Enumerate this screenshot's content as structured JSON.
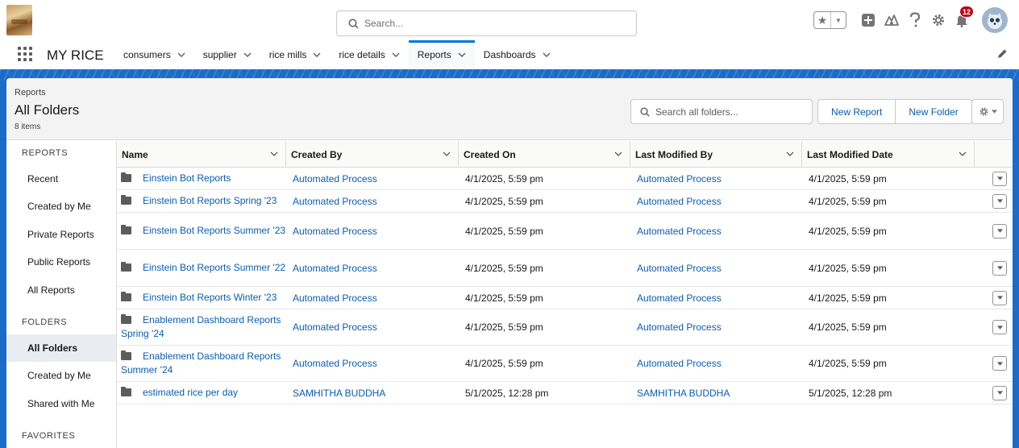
{
  "header": {
    "search_placeholder": "Search...",
    "notification_count": "12",
    "icons": [
      "logo",
      "search-icon",
      "star-icon",
      "chevron-down-icon",
      "add-icon",
      "trailhead-icon",
      "help-icon",
      "gear-icon",
      "bell-icon",
      "avatar"
    ]
  },
  "nav": {
    "app_name": "MY RICE",
    "items": [
      {
        "label": "consumers"
      },
      {
        "label": "supplier"
      },
      {
        "label": "rice mills"
      },
      {
        "label": "rice details"
      },
      {
        "label": "Reports"
      },
      {
        "label": "Dashboards"
      }
    ],
    "active": "Reports"
  },
  "page": {
    "eyebrow": "Reports",
    "title": "All Folders",
    "count": "8 items",
    "search_placeholder": "Search all folders...",
    "new_report": "New Report",
    "new_folder": "New Folder"
  },
  "sidebar": {
    "sections": [
      {
        "label": "REPORTS"
      },
      {
        "label": "FOLDERS"
      },
      {
        "label": "FAVORITES"
      }
    ],
    "items": [
      {
        "label": "Recent"
      },
      {
        "label": "Created by Me"
      },
      {
        "label": "Private Reports"
      },
      {
        "label": "Public Reports"
      },
      {
        "label": "All Reports"
      },
      {
        "label": "All Folders"
      },
      {
        "label": "Created by Me"
      },
      {
        "label": "Shared with Me"
      }
    ],
    "active": "All Folders"
  },
  "table": {
    "columns": [
      {
        "label": "Name"
      },
      {
        "label": "Created By"
      },
      {
        "label": "Created On"
      },
      {
        "label": "Last Modified By"
      },
      {
        "label": "Last Modified Date"
      }
    ],
    "rows": [
      {
        "name": "Einstein Bot Reports",
        "created_by": "Automated Process",
        "created_on": "4/1/2025, 5:59 pm",
        "modified_by": "Automated Process",
        "modified_date": "4/1/2025, 5:59 pm"
      },
      {
        "name": "Einstein Bot Reports Spring '23",
        "created_by": "Automated Process",
        "created_on": "4/1/2025, 5:59 pm",
        "modified_by": "Automated Process",
        "modified_date": "4/1/2025, 5:59 pm"
      },
      {
        "name": "Einstein Bot Reports Summer '23",
        "created_by": "Automated Process",
        "created_on": "4/1/2025, 5:59 pm",
        "modified_by": "Automated Process",
        "modified_date": "4/1/2025, 5:59 pm"
      },
      {
        "name": "Einstein Bot Reports Summer '22",
        "created_by": "Automated Process",
        "created_on": "4/1/2025, 5:59 pm",
        "modified_by": "Automated Process",
        "modified_date": "4/1/2025, 5:59 pm"
      },
      {
        "name": "Einstein Bot Reports Winter '23",
        "created_by": "Automated Process",
        "created_on": "4/1/2025, 5:59 pm",
        "modified_by": "Automated Process",
        "modified_date": "4/1/2025, 5:59 pm"
      },
      {
        "name": "Enablement Dashboard Reports Spring '24",
        "created_by": "Automated Process",
        "created_on": "4/1/2025, 5:59 pm",
        "modified_by": "Automated Process",
        "modified_date": "4/1/2025, 5:59 pm"
      },
      {
        "name": "Enablement Dashboard Reports Summer '24",
        "created_by": "Automated Process",
        "created_on": "4/1/2025, 5:59 pm",
        "modified_by": "Automated Process",
        "modified_date": "4/1/2025, 5:59 pm"
      },
      {
        "name": "estimated rice per day",
        "created_by": "SAMHITHA BUDDHA",
        "created_on": "5/1/2025, 12:28 pm",
        "modified_by": "SAMHITHA BUDDHA",
        "modified_date": "5/1/2025, 12:28 pm"
      }
    ]
  },
  "colors": {
    "brand": "#0176d3",
    "link": "#0b5cab",
    "band": "#1b6bc9",
    "badge": "#ba0517"
  }
}
